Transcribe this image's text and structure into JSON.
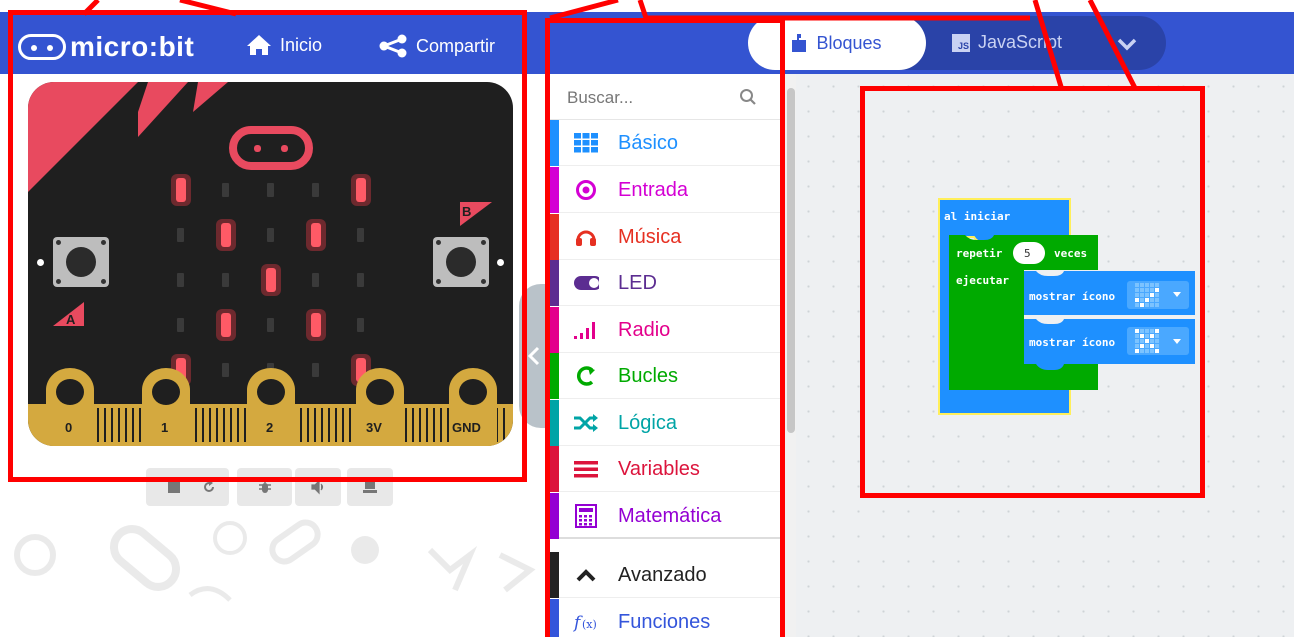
{
  "header": {
    "logo_text": "micro:bit",
    "home_label": "Inicio",
    "share_label": "Compartir",
    "tabs": {
      "blocks_label": "Bloques",
      "js_label": "JavaScript",
      "js_badge": "JS"
    }
  },
  "simulator": {
    "button_a_label": "A",
    "button_b_label": "B",
    "pins": [
      "0",
      "1",
      "2",
      "3V",
      "GND"
    ],
    "led_matrix": [
      [
        1,
        0,
        0,
        0,
        1
      ],
      [
        0,
        1,
        0,
        1,
        0
      ],
      [
        0,
        0,
        1,
        0,
        0
      ],
      [
        0,
        1,
        0,
        1,
        0
      ],
      [
        1,
        0,
        0,
        0,
        1
      ]
    ],
    "controls": [
      "stop-icon",
      "restart-icon",
      "debug-icon",
      "mute-icon",
      "screenshot-icon"
    ]
  },
  "toolbox": {
    "search_placeholder": "Buscar...",
    "categories": [
      {
        "label": "Básico",
        "color": "#1e90ff",
        "icon": "grid-icon"
      },
      {
        "label": "Entrada",
        "color": "#d400d4",
        "icon": "target-icon"
      },
      {
        "label": "Música",
        "color": "#e63022",
        "icon": "headphones-icon"
      },
      {
        "label": "LED",
        "color": "#5c2d91",
        "icon": "toggle-icon"
      },
      {
        "label": "Radio",
        "color": "#e3008c",
        "icon": "signal-bars-icon"
      },
      {
        "label": "Bucles",
        "color": "#00aa00",
        "icon": "loop-arrow-icon"
      },
      {
        "label": "Lógica",
        "color": "#00a4a6",
        "icon": "shuffle-icon"
      },
      {
        "label": "Variables",
        "color": "#dc143c",
        "icon": "lines-icon"
      },
      {
        "label": "Matemática",
        "color": "#9400d3",
        "icon": "calculator-icon"
      },
      {
        "label": "Avanzado",
        "color": "#222222",
        "icon": "chevron-up-icon"
      },
      {
        "label": "Funciones",
        "color": "#3455db",
        "icon": "function-icon"
      }
    ]
  },
  "workspace": {
    "on_start_label": "al iniciar",
    "repeat_label": "repetir",
    "repeat_count": "5",
    "times_label": "veces",
    "do_label": "ejecutar",
    "show_icon_label_1": "mostrar ícono",
    "show_icon_label_2": "mostrar ícono"
  },
  "colors": {
    "header": "#3454d1",
    "block_basic": "#1e90ff",
    "block_loops": "#00aa00",
    "annotation": "#ff0000"
  }
}
